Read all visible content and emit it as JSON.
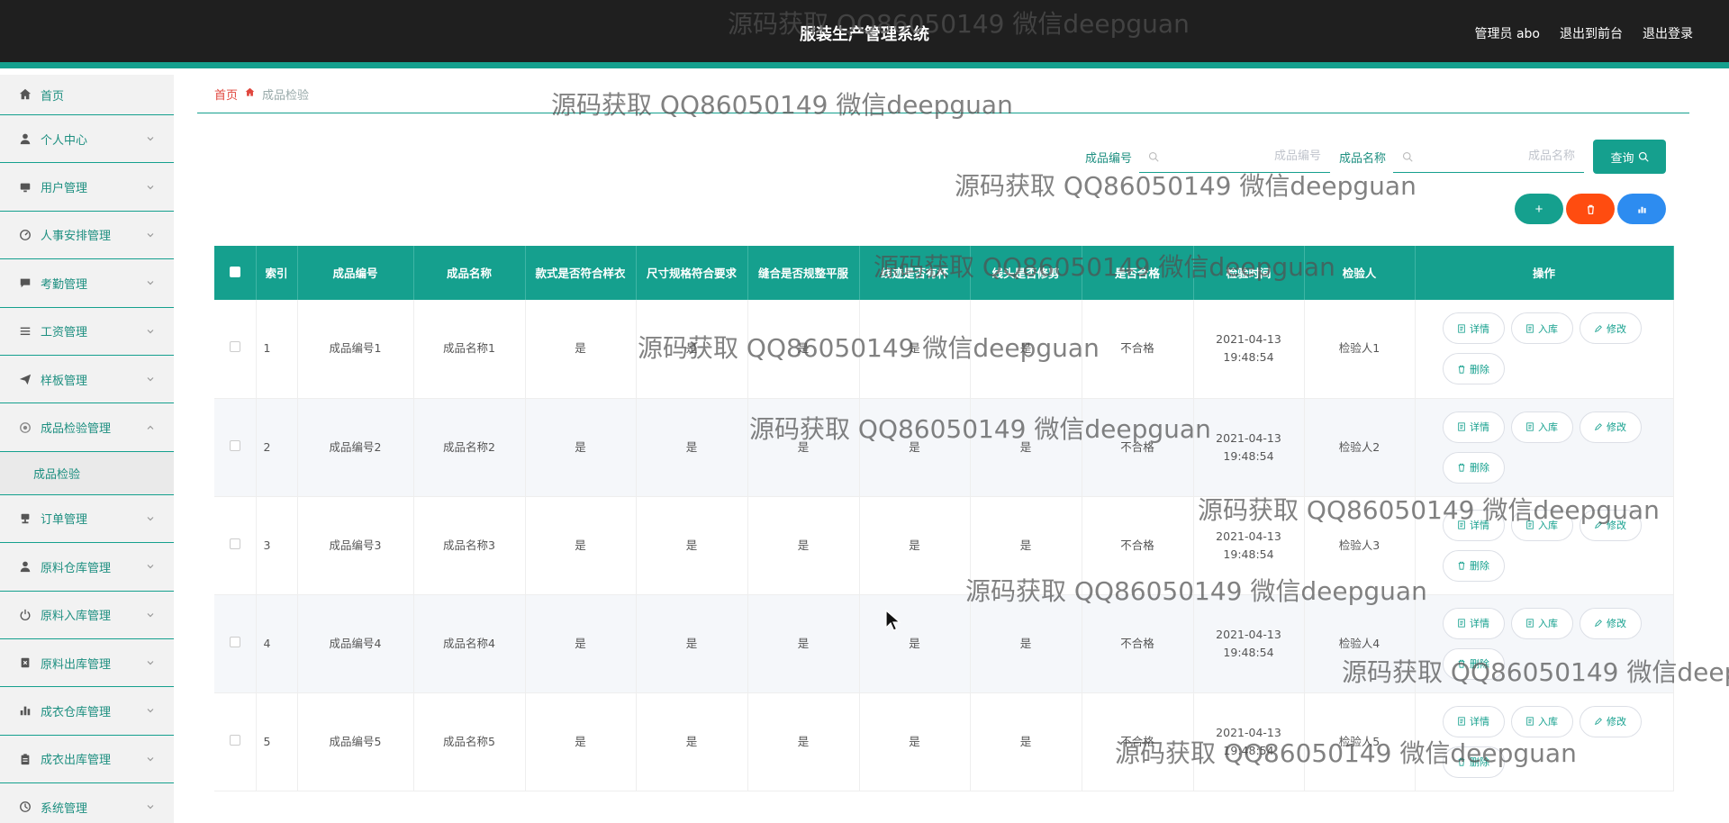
{
  "header": {
    "title": "服装生产管理系统",
    "user_label": "管理员 abo",
    "to_front": "退出到前台",
    "logout": "退出登录"
  },
  "sidebar": {
    "home": "首页",
    "items": [
      {
        "label": "个人中心",
        "icon": "user-icon"
      },
      {
        "label": "用户管理",
        "icon": "monitor-icon"
      },
      {
        "label": "人事安排管理",
        "icon": "gauge-icon"
      },
      {
        "label": "考勤管理",
        "icon": "chat-icon"
      },
      {
        "label": "工资管理",
        "icon": "list-icon"
      },
      {
        "label": "样板管理",
        "icon": "send-icon"
      },
      {
        "label": "成品检验管理",
        "icon": "settings-icon",
        "expanded": true
      },
      {
        "label": "订单管理",
        "icon": "stamp-icon"
      },
      {
        "label": "原料仓库管理",
        "icon": "user-icon"
      },
      {
        "label": "原料入库管理",
        "icon": "power-icon"
      },
      {
        "label": "原料出库管理",
        "icon": "delete-box-icon"
      },
      {
        "label": "成衣仓库管理",
        "icon": "bar-chart-icon"
      },
      {
        "label": "成衣出库管理",
        "icon": "clipboard-icon"
      },
      {
        "label": "系统管理",
        "icon": "compass-icon"
      }
    ],
    "submenu_active": "成品检验"
  },
  "breadcrumb": {
    "home": "首页",
    "current": "成品检验"
  },
  "search": {
    "field1_label": "成品编号",
    "field1_placeholder": "成品编号",
    "field2_label": "成品名称",
    "field2_placeholder": "成品名称",
    "query_label": "查询"
  },
  "toolbar": {
    "add": "+"
  },
  "table": {
    "headers": [
      "索引",
      "成品编号",
      "成品名称",
      "款式是否符合样衣",
      "尺寸规格符合要求",
      "缝合是否规整平服",
      "线迹是否有杯",
      "线头是否修剪",
      "是否合格",
      "检验时间",
      "检验人",
      "操作"
    ],
    "rows": [
      {
        "index": "1",
        "code": "成品编号1",
        "name": "成品名称1",
        "c1": "是",
        "c2": "是",
        "c3": "是",
        "c4": "是",
        "c5": "是",
        "qualified": "不合格",
        "time": "2021-04-13 19:48:54",
        "inspector": "检验人1"
      },
      {
        "index": "2",
        "code": "成品编号2",
        "name": "成品名称2",
        "c1": "是",
        "c2": "是",
        "c3": "是",
        "c4": "是",
        "c5": "是",
        "qualified": "不合格",
        "time": "2021-04-13 19:48:54",
        "inspector": "检验人2"
      },
      {
        "index": "3",
        "code": "成品编号3",
        "name": "成品名称3",
        "c1": "是",
        "c2": "是",
        "c3": "是",
        "c4": "是",
        "c5": "是",
        "qualified": "不合格",
        "time": "2021-04-13 19:48:54",
        "inspector": "检验人3"
      },
      {
        "index": "4",
        "code": "成品编号4",
        "name": "成品名称4",
        "c1": "是",
        "c2": "是",
        "c3": "是",
        "c4": "是",
        "c5": "是",
        "qualified": "不合格",
        "time": "2021-04-13 19:48:54",
        "inspector": "检验人4"
      },
      {
        "index": "5",
        "code": "成品编号5",
        "name": "成品名称5",
        "c1": "是",
        "c2": "是",
        "c3": "是",
        "c4": "是",
        "c5": "是",
        "qualified": "不合格",
        "time": "2021-04-13 19:48:54",
        "inspector": "检验人5"
      }
    ],
    "ops": {
      "detail": "详情",
      "stock_in": "入库",
      "edit": "修改",
      "delete": "删除"
    }
  },
  "watermark": "源码获取 QQ86050149 微信deepguan",
  "colors": {
    "accent": "#15a08e",
    "danger": "#ff4c10",
    "info": "#2d8cf0",
    "header_bg": "#1f1f1f"
  }
}
